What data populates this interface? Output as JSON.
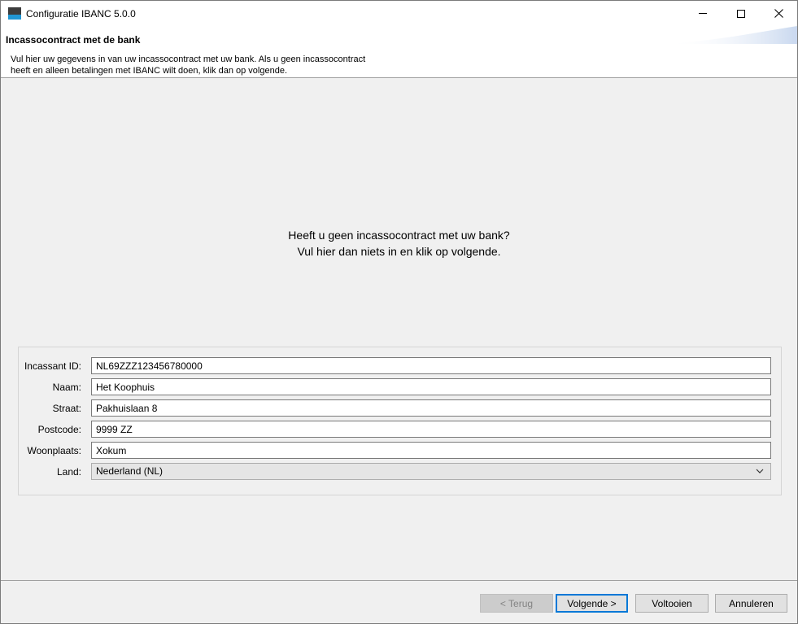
{
  "window": {
    "title": "Configuratie IBANC 5.0.0"
  },
  "header": {
    "title": "Incassocontract met de bank",
    "description_line1": "Vul hier uw gegevens in van uw incassocontract met uw bank. Als u geen incassocontract",
    "description_line2": "heeft en alleen betalingen met IBANC wilt doen, klik dan op volgende."
  },
  "hint": {
    "line1": "Heeft u geen incassocontract met uw bank?",
    "line2": "Vul hier dan niets in en klik op volgende."
  },
  "form": {
    "creditor_id": {
      "label": "Incassant ID:",
      "value": "NL69ZZZ123456780000"
    },
    "name": {
      "label": "Naam:",
      "value": "Het Koophuis"
    },
    "street": {
      "label": "Straat:",
      "value": "Pakhuislaan 8"
    },
    "postcode": {
      "label": "Postcode:",
      "value": "9999 ZZ"
    },
    "city": {
      "label": "Woonplaats:",
      "value": "Xokum"
    },
    "country": {
      "label": "Land:",
      "value": "Nederland (NL)"
    }
  },
  "buttons": {
    "back": "< Terug",
    "next": "Volgende >",
    "finish": "Voltooien",
    "cancel": "Annuleren"
  },
  "colors": {
    "accent": "#0078d7",
    "icon_blue": "#2196d3"
  }
}
